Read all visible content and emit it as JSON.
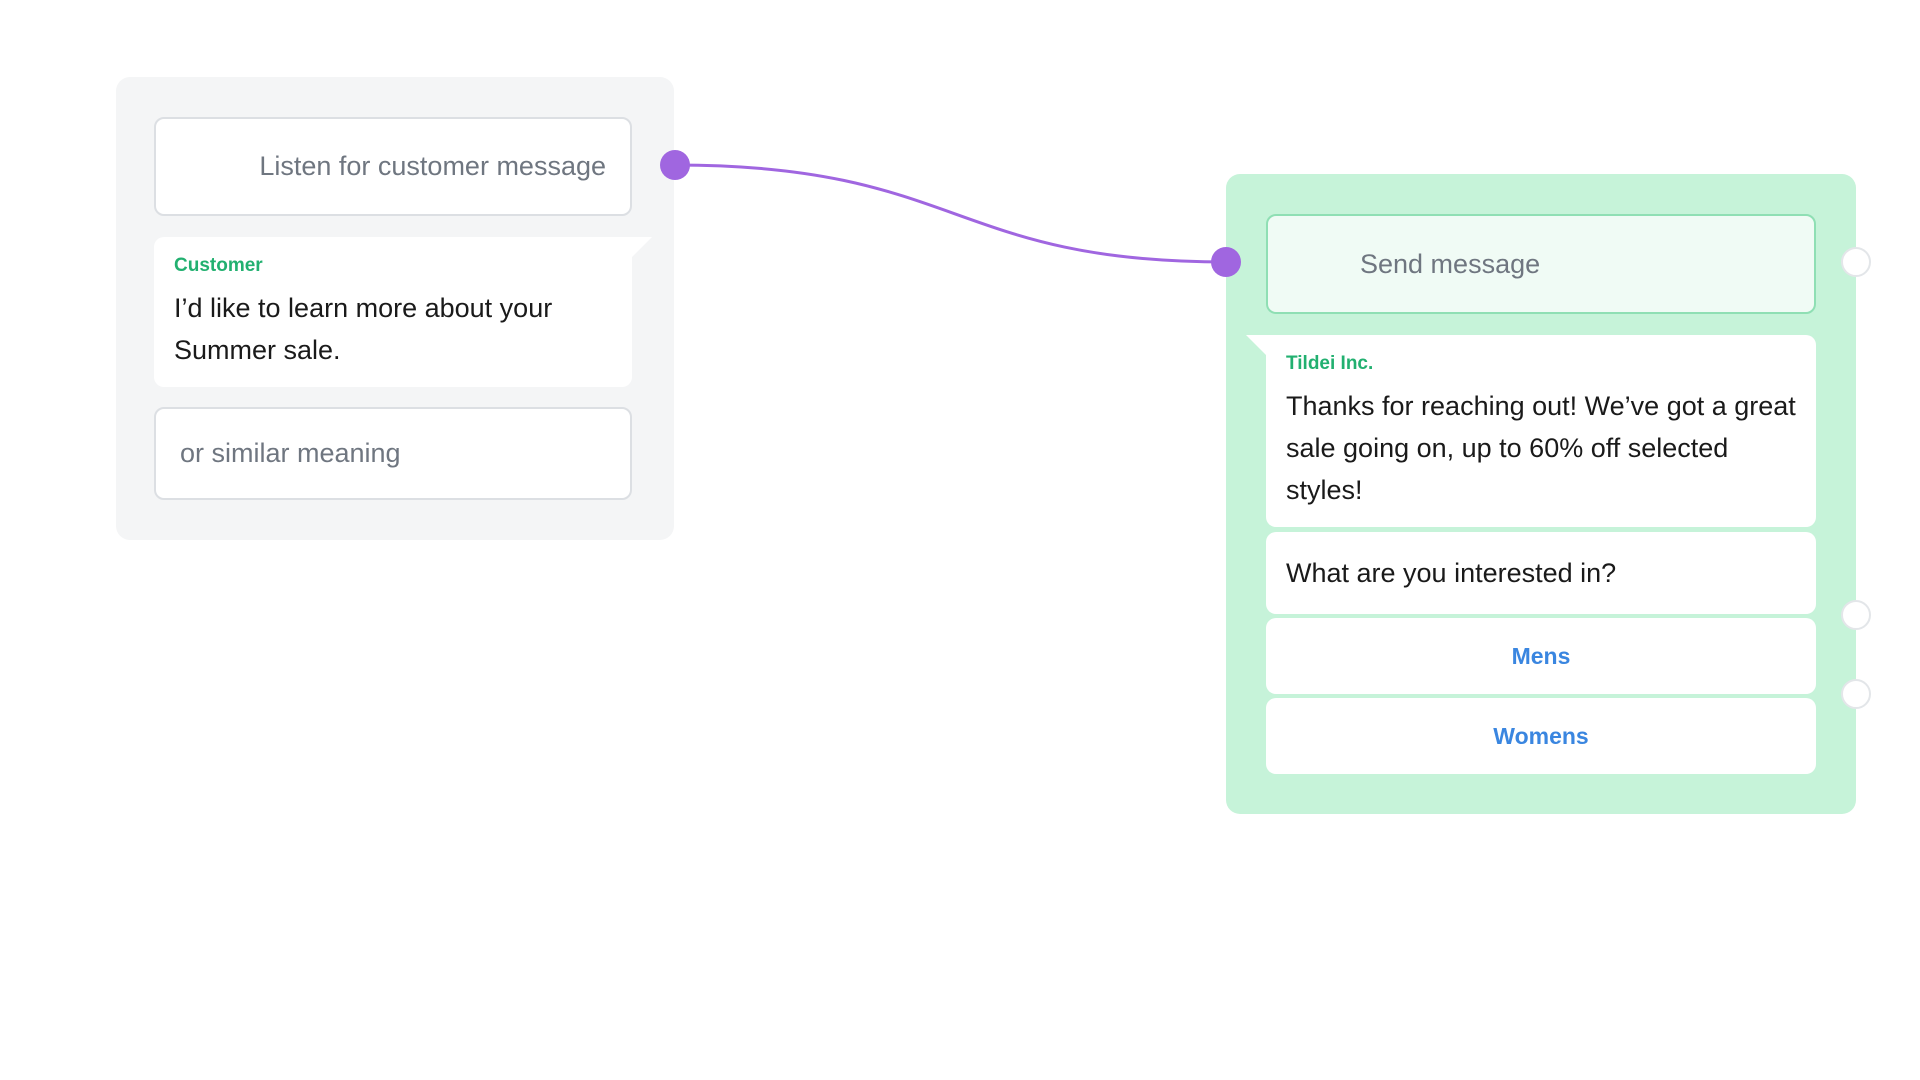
{
  "listen_node": {
    "header": "Listen for customer message",
    "sender": "Customer",
    "message": "I’d like to learn more about your Summer sale.",
    "similar_placeholder": "or similar meaning"
  },
  "send_node": {
    "header": "Send message",
    "sender": "Tildei Inc.",
    "message": "Thanks for reaching out! We’ve got a great sale going on, up to 60% off selected styles!",
    "question": "What are you interested in?",
    "options": [
      {
        "label": "Mens"
      },
      {
        "label": "Womens"
      }
    ]
  },
  "colors": {
    "connector": "#a066e0",
    "send_node_bg": "#c6f3d9",
    "sender_label": "#22b070",
    "option_text": "#3a86e0"
  }
}
